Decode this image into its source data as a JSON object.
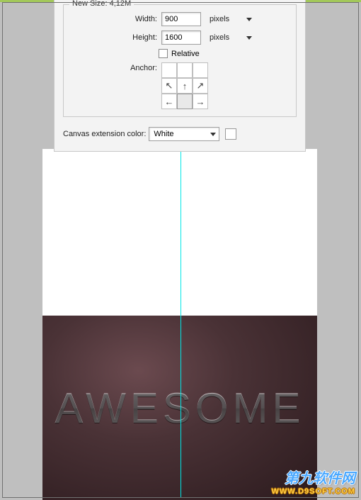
{
  "dialog": {
    "newsize_label": "New Size:",
    "newsize_value": "4,12M",
    "width_label": "Width:",
    "width_value": "900",
    "width_unit": "pixels",
    "height_label": "Height:",
    "height_value": "1600",
    "height_unit": "pixels",
    "relative_label": "Relative",
    "relative_checked": false,
    "anchor_label": "Anchor:",
    "anchor_arrows": [
      "",
      "",
      "",
      "↖",
      "↑",
      "↗",
      "←",
      "·",
      "→"
    ],
    "ext_label": "Canvas extension color:",
    "ext_value": "White",
    "ext_swatch_color": "#ffffff"
  },
  "canvas": {
    "text": "AWESOME",
    "guide_color": "#00e7e7",
    "dark_gradient_center": "#6b4a4f",
    "dark_gradient_edge": "#2b1a1d"
  },
  "watermark": {
    "line1": "第九软件网",
    "line2": "WWW.D9SOFT.COM"
  }
}
